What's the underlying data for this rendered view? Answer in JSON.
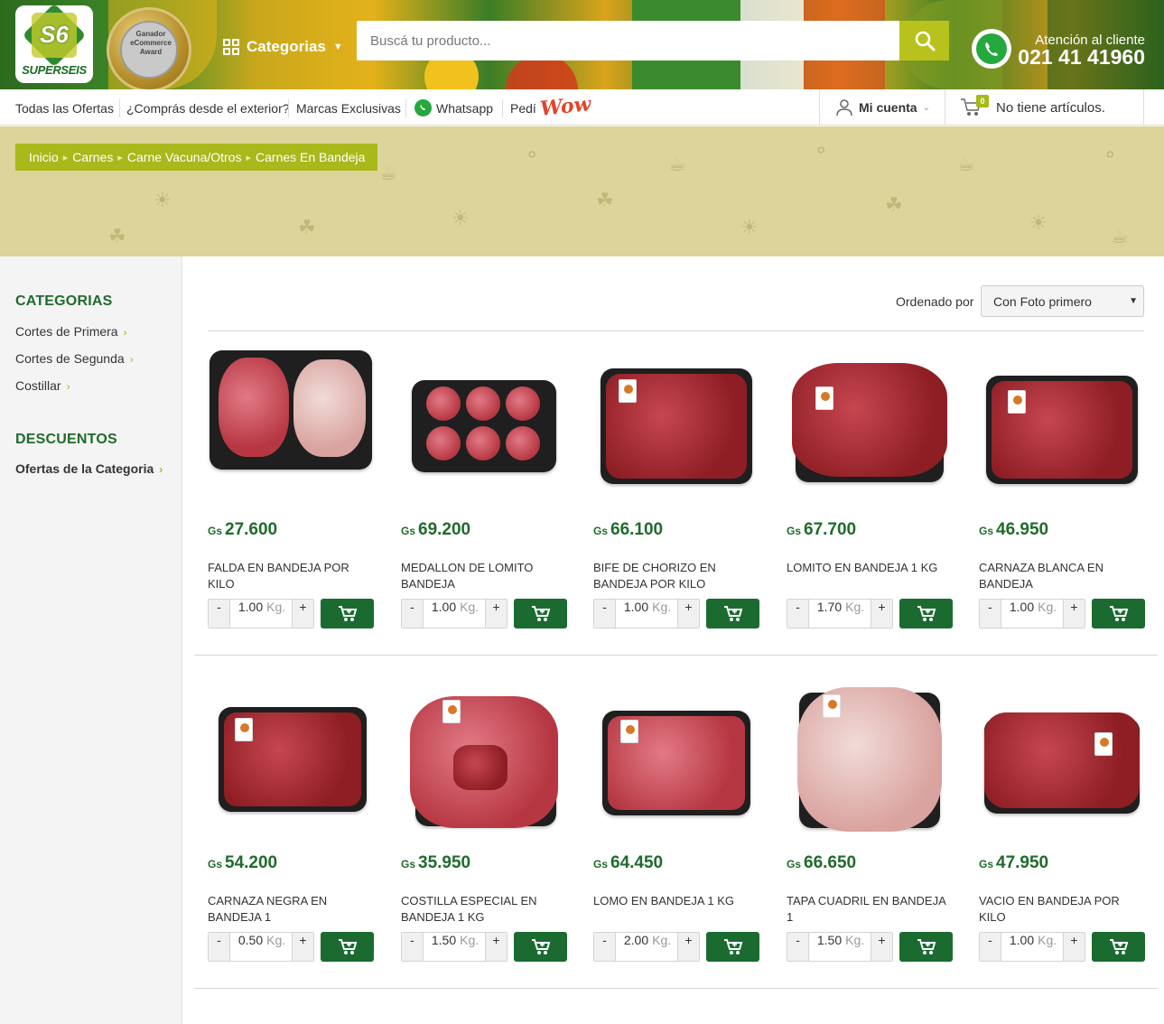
{
  "header": {
    "logo_text": "S6",
    "brand": "SUPERSEIS",
    "award_text": "Ganador eCommerce Award",
    "categorias_label": "Categorias",
    "search_placeholder": "Buscá tu producto...",
    "atencion_label": "Atención al cliente",
    "phone": "021 41 41960"
  },
  "subnav": {
    "ofertas": "Todas las Ofertas",
    "exterior": "¿Comprás desde el exterior?",
    "marcas": "Marcas Exclusivas",
    "whatsapp": "Whatsapp",
    "pedi": "Pedí",
    "wow": "Wow",
    "cuenta": "Mi cuenta",
    "cart_count": "0",
    "cart_text": "No tiene artículos."
  },
  "breadcrumb": [
    "Inicio",
    "Carnes",
    "Carne Vacuna/Otros",
    "Carnes En Bandeja"
  ],
  "sidebar": {
    "categorias_title": "CATEGORIAS",
    "categorias": [
      "Cortes de Primera",
      "Cortes de Segunda",
      "Costillar"
    ],
    "descuentos_title": "DESCUENTOS",
    "descuentos": [
      "Ofertas de la Categoria"
    ]
  },
  "sort": {
    "label": "Ordenado por",
    "selected": "Con Foto primero"
  },
  "currency": "Gs",
  "unit": "Kg.",
  "products": [
    {
      "price": "27.600",
      "name": "FALDA EN BANDEJA POR KILO",
      "qty": "1.00"
    },
    {
      "price": "69.200",
      "name": "MEDALLON DE LOMITO BANDEJA",
      "qty": "1.00"
    },
    {
      "price": "66.100",
      "name": "BIFE DE CHORIZO EN BANDEJA POR KILO",
      "qty": "1.00"
    },
    {
      "price": "67.700",
      "name": "LOMITO EN BANDEJA 1 KG",
      "qty": "1.70"
    },
    {
      "price": "46.950",
      "name": "CARNAZA BLANCA EN BANDEJA",
      "qty": "1.00"
    },
    {
      "price": "54.200",
      "name": "CARNAZA NEGRA EN BANDEJA 1",
      "qty": "0.50"
    },
    {
      "price": "35.950",
      "name": "COSTILLA ESPECIAL EN BANDEJA 1 KG",
      "qty": "1.50"
    },
    {
      "price": "64.450",
      "name": "LOMO EN BANDEJA 1 KG",
      "qty": "2.00"
    },
    {
      "price": "66.650",
      "name": "TAPA CUADRIL EN BANDEJA 1",
      "qty": "1.50"
    },
    {
      "price": "47.950",
      "name": "VACIO EN BANDEJA POR KILO",
      "qty": "1.00"
    }
  ],
  "colors": {
    "brand_green": "#1f6b2b",
    "accent_lime": "#a9b81b",
    "button_green": "#1b6b31",
    "banner_bg": "#dcd49a"
  }
}
